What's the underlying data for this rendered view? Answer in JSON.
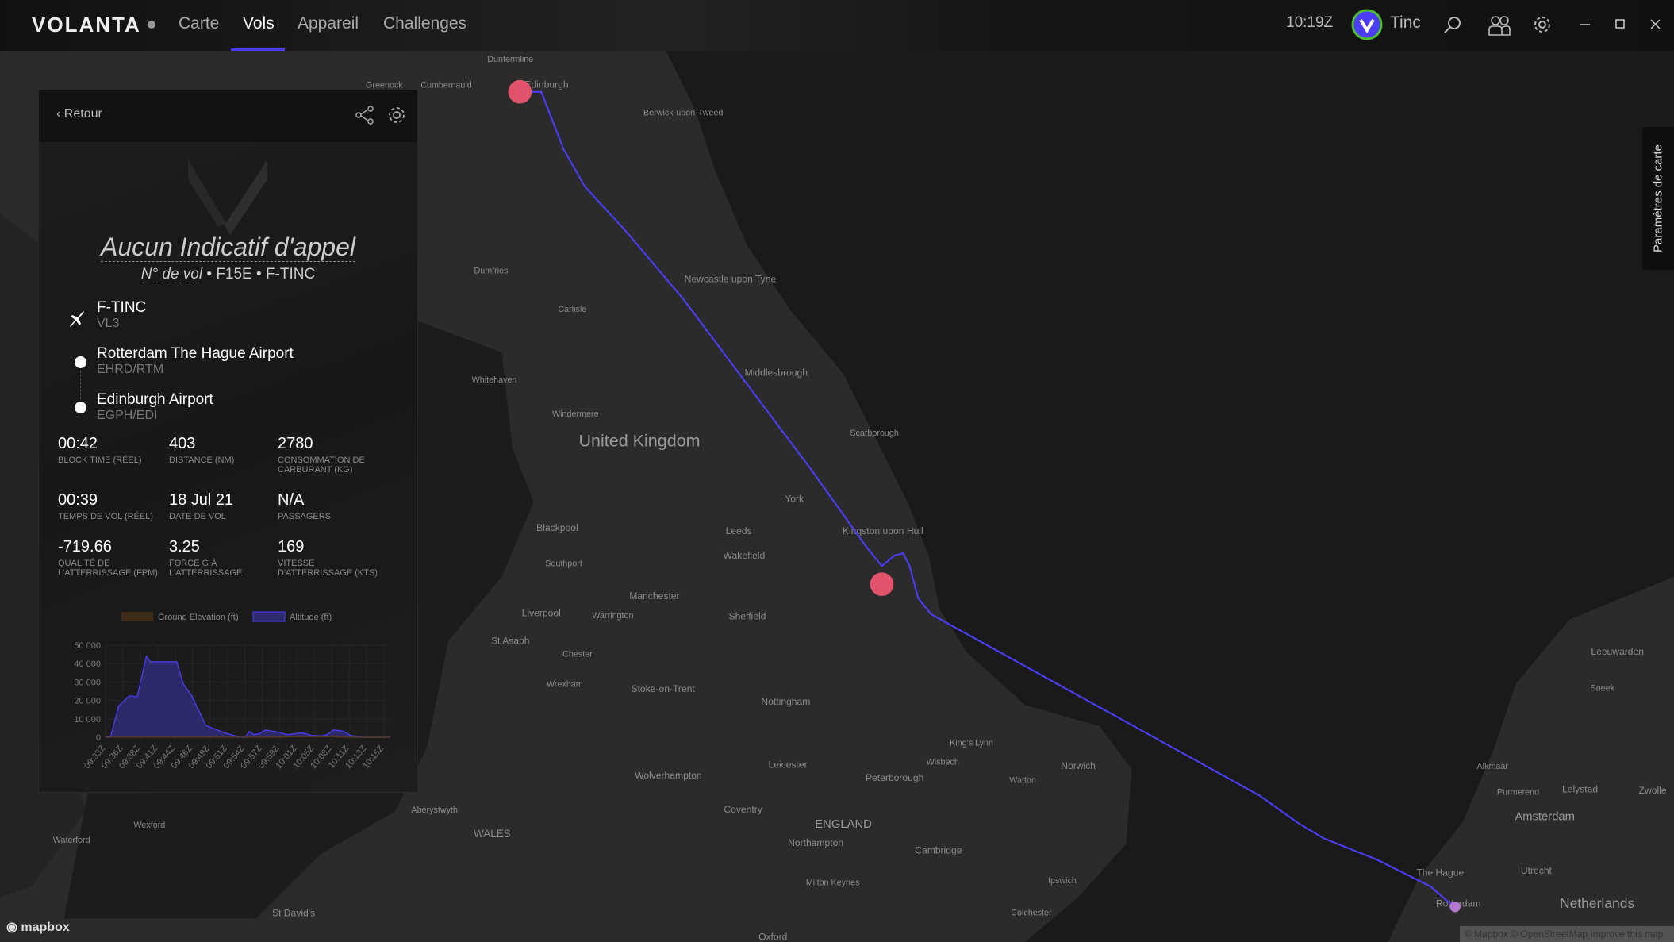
{
  "topbar": {
    "brand": "VOLANTA",
    "nav": [
      {
        "label": "Carte"
      },
      {
        "label": "Vols",
        "active": true
      },
      {
        "label": "Appareil"
      },
      {
        "label": "Challenges"
      }
    ],
    "time": "10:19Z",
    "user": "Tinc",
    "icons": [
      "search-icon",
      "friends-icon",
      "gear-icon",
      "minimize-icon",
      "maximize-icon",
      "close-icon"
    ],
    "accent": "#4b3df5"
  },
  "panel": {
    "back_label": "Retour",
    "callsign": "Aucun Indicatif d'appel",
    "flight_no": "N° de vol",
    "aircraft_type": "F15E",
    "registration": "F-TINC",
    "aircraft": {
      "name": "F-TINC",
      "sub": "VL3"
    },
    "departure": {
      "name": "Rotterdam The Hague Airport",
      "code": "EHRD/RTM"
    },
    "arrival": {
      "name": "Edinburgh Airport",
      "code": "EGPH/EDI"
    },
    "stats": [
      {
        "value": "00:42",
        "label": "BLOCK TIME (RÉEL)"
      },
      {
        "value": "403",
        "label": "DISTANCE (NM)"
      },
      {
        "value": "2780",
        "label": "CONSOMMATION DE CARBURANT (KG)"
      },
      {
        "value": "00:39",
        "label": "TEMPS DE VOL (RÉEL)"
      },
      {
        "value": "18 Jul 21",
        "label": "DATE DE VOL"
      },
      {
        "value": "N/A",
        "label": "PASSAGERS"
      },
      {
        "value": "-719.66",
        "label": "QUALITÉ DE L'ATTERRISSAGE (FPM)"
      },
      {
        "value": "3.25",
        "label": "FORCE G À L'ATTERRISSAGE"
      },
      {
        "value": "169",
        "label": "VITESSE D'ATTERRISSAGE (KTS)"
      }
    ]
  },
  "chart_data": {
    "type": "area",
    "legend": [
      {
        "name": "Ground Elevation (ft)",
        "color": "#3d2c19"
      },
      {
        "name": "Altitude (ft)",
        "color": "#2f2a6e",
        "stroke": "#4b3df5"
      }
    ],
    "legend_position": "top",
    "ylim": [
      0,
      50000
    ],
    "yticks": [
      "50 000",
      "40 000",
      "30 000",
      "20 000",
      "10 000",
      "0"
    ],
    "xticks": [
      "09:33Z",
      "09:36Z",
      "09:38Z",
      "09:41Z",
      "09:44Z",
      "09:46Z",
      "09:49Z",
      "09:51Z",
      "09:54Z",
      "09:57Z",
      "09:59Z",
      "10:01Z",
      "10:05Z",
      "10:08Z",
      "10:11Z",
      "10:13Z",
      "10:15Z"
    ],
    "xrange": [
      "09:33:00",
      "10:16:12"
    ],
    "grid": true,
    "series": [
      {
        "name": "Altitude (ft)",
        "points": [
          [
            "09:33:00",
            0
          ],
          [
            "09:33:48",
            700
          ],
          [
            "09:35:00",
            17000
          ],
          [
            "09:36:36",
            22500
          ],
          [
            "09:37:48",
            22000
          ],
          [
            "09:39:12",
            44000
          ],
          [
            "09:39:48",
            41000
          ],
          [
            "09:43:48",
            41000
          ],
          [
            "09:44:48",
            29000
          ],
          [
            "09:46:00",
            23000
          ],
          [
            "09:48:12",
            6500
          ],
          [
            "09:49:00",
            5300
          ],
          [
            "09:51:00",
            2500
          ],
          [
            "09:53:24",
            0
          ],
          [
            "09:54:12",
            0
          ],
          [
            "09:54:48",
            3200
          ],
          [
            "09:55:24",
            1500
          ],
          [
            "09:56:12",
            1700
          ],
          [
            "09:57:12",
            3900
          ],
          [
            "09:59:00",
            2900
          ],
          [
            "10:00:36",
            1400
          ],
          [
            "10:02:36",
            2400
          ],
          [
            "10:03:24",
            1900
          ],
          [
            "10:04:12",
            1000
          ],
          [
            "10:05:48",
            700
          ],
          [
            "10:06:36",
            1400
          ],
          [
            "10:07:36",
            4000
          ],
          [
            "10:09:00",
            3300
          ],
          [
            "10:10:12",
            1000
          ],
          [
            "10:11:48",
            0
          ],
          [
            "10:16:12",
            0
          ]
        ]
      },
      {
        "name": "Ground Elevation (ft)",
        "points": [
          [
            "09:33:00",
            0
          ],
          [
            "09:59:30",
            0
          ],
          [
            "10:01:00",
            300
          ],
          [
            "10:04:00",
            500
          ],
          [
            "10:06:00",
            200
          ],
          [
            "10:07:30",
            600
          ],
          [
            "10:08:30",
            0
          ],
          [
            "10:16:12",
            0
          ]
        ]
      }
    ]
  },
  "map": {
    "settings_label": "Paramètres de carte",
    "attribution": "© Mapbox © OpenStreetMap  Improve this map",
    "provider": "mapbox",
    "route_color": "#4b3df5",
    "labels": [
      {
        "t": "United Kingdom",
        "big": true
      },
      {
        "t": "ENGLAND",
        "big": false
      },
      {
        "t": "WALES"
      },
      {
        "t": "Netherlands"
      },
      {
        "t": "Edinburgh"
      },
      {
        "t": "Dunfermline"
      },
      {
        "t": "Berwick-upon-Tweed"
      },
      {
        "t": "Newcastle upon Tyne"
      },
      {
        "t": "Middlesbrough"
      },
      {
        "t": "Carlisle"
      },
      {
        "t": "Dumfries"
      },
      {
        "t": "Whitehaven"
      },
      {
        "t": "Windermere"
      },
      {
        "t": "Scarborough"
      },
      {
        "t": "York"
      },
      {
        "t": "Kingston upon Hull"
      },
      {
        "t": "Leeds"
      },
      {
        "t": "Wakefield"
      },
      {
        "t": "Blackpool"
      },
      {
        "t": "Southport"
      },
      {
        "t": "Manchester"
      },
      {
        "t": "Liverpool"
      },
      {
        "t": "Warrington"
      },
      {
        "t": "Sheffield"
      },
      {
        "t": "Chester"
      },
      {
        "t": "Wrexham"
      },
      {
        "t": "St Asaph"
      },
      {
        "t": "Stoke-on-Trent"
      },
      {
        "t": "Nottingham"
      },
      {
        "t": "Leicester"
      },
      {
        "t": "Wolverhampton"
      },
      {
        "t": "Coventry"
      },
      {
        "t": "Peterborough"
      },
      {
        "t": "King's Lynn"
      },
      {
        "t": "Wisbech"
      },
      {
        "t": "Norwich"
      },
      {
        "t": "Watton"
      },
      {
        "t": "Northampton"
      },
      {
        "t": "Cambridge"
      },
      {
        "t": "Milton Keynes"
      },
      {
        "t": "Ipswich"
      },
      {
        "t": "Colchester"
      },
      {
        "t": "Aberystwyth"
      },
      {
        "t": "St David's"
      },
      {
        "t": "Wexford"
      },
      {
        "t": "Waterford"
      },
      {
        "t": "Oxford"
      },
      {
        "t": "Amsterdam"
      },
      {
        "t": "The Hague"
      },
      {
        "t": "Rotterdam"
      },
      {
        "t": "Utrecht"
      },
      {
        "t": "Lelystad"
      },
      {
        "t": "Leeuwarden"
      },
      {
        "t": "Alkmaar"
      },
      {
        "t": "Purmerend"
      },
      {
        "t": "Zwolle"
      },
      {
        "t": "Sneek"
      },
      {
        "t": "Greenock"
      },
      {
        "t": "Cumbernauld"
      }
    ]
  }
}
